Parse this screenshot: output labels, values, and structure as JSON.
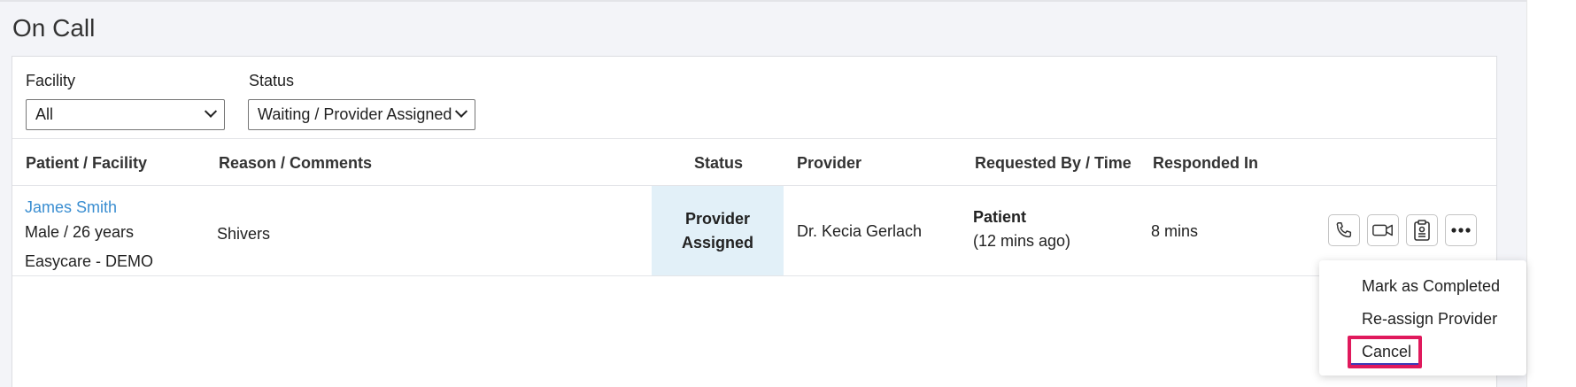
{
  "page": {
    "title": "On Call"
  },
  "filters": {
    "facility": {
      "label": "Facility",
      "value": "All"
    },
    "status": {
      "label": "Status",
      "value": "Waiting / Provider Assigned"
    }
  },
  "table": {
    "columns": [
      "Patient / Facility",
      "Reason / Comments",
      "Status",
      "Provider",
      "Requested By / Time",
      "Responded In"
    ],
    "rows": [
      {
        "patient_name": "James Smith",
        "patient_info": "Male / 26 years",
        "facility": "Easycare - DEMO",
        "reason": "Shivers",
        "status_line1": "Provider",
        "status_line2": "Assigned",
        "provider": "Dr. Kecia Gerlach",
        "requested_by": "Patient",
        "requested_time": "(12 mins ago)",
        "responded_in": "8 mins"
      }
    ]
  },
  "actions": {
    "icons": [
      "phone-icon",
      "video-icon",
      "clipboard-icon",
      "more-icon"
    ]
  },
  "menu": {
    "items": [
      "Mark as Completed",
      "Re-assign Provider",
      "Cancel"
    ]
  },
  "colors": {
    "link": "#3a8ed1",
    "status_bg": "#e2f0f8",
    "highlight": "#e0195c"
  }
}
